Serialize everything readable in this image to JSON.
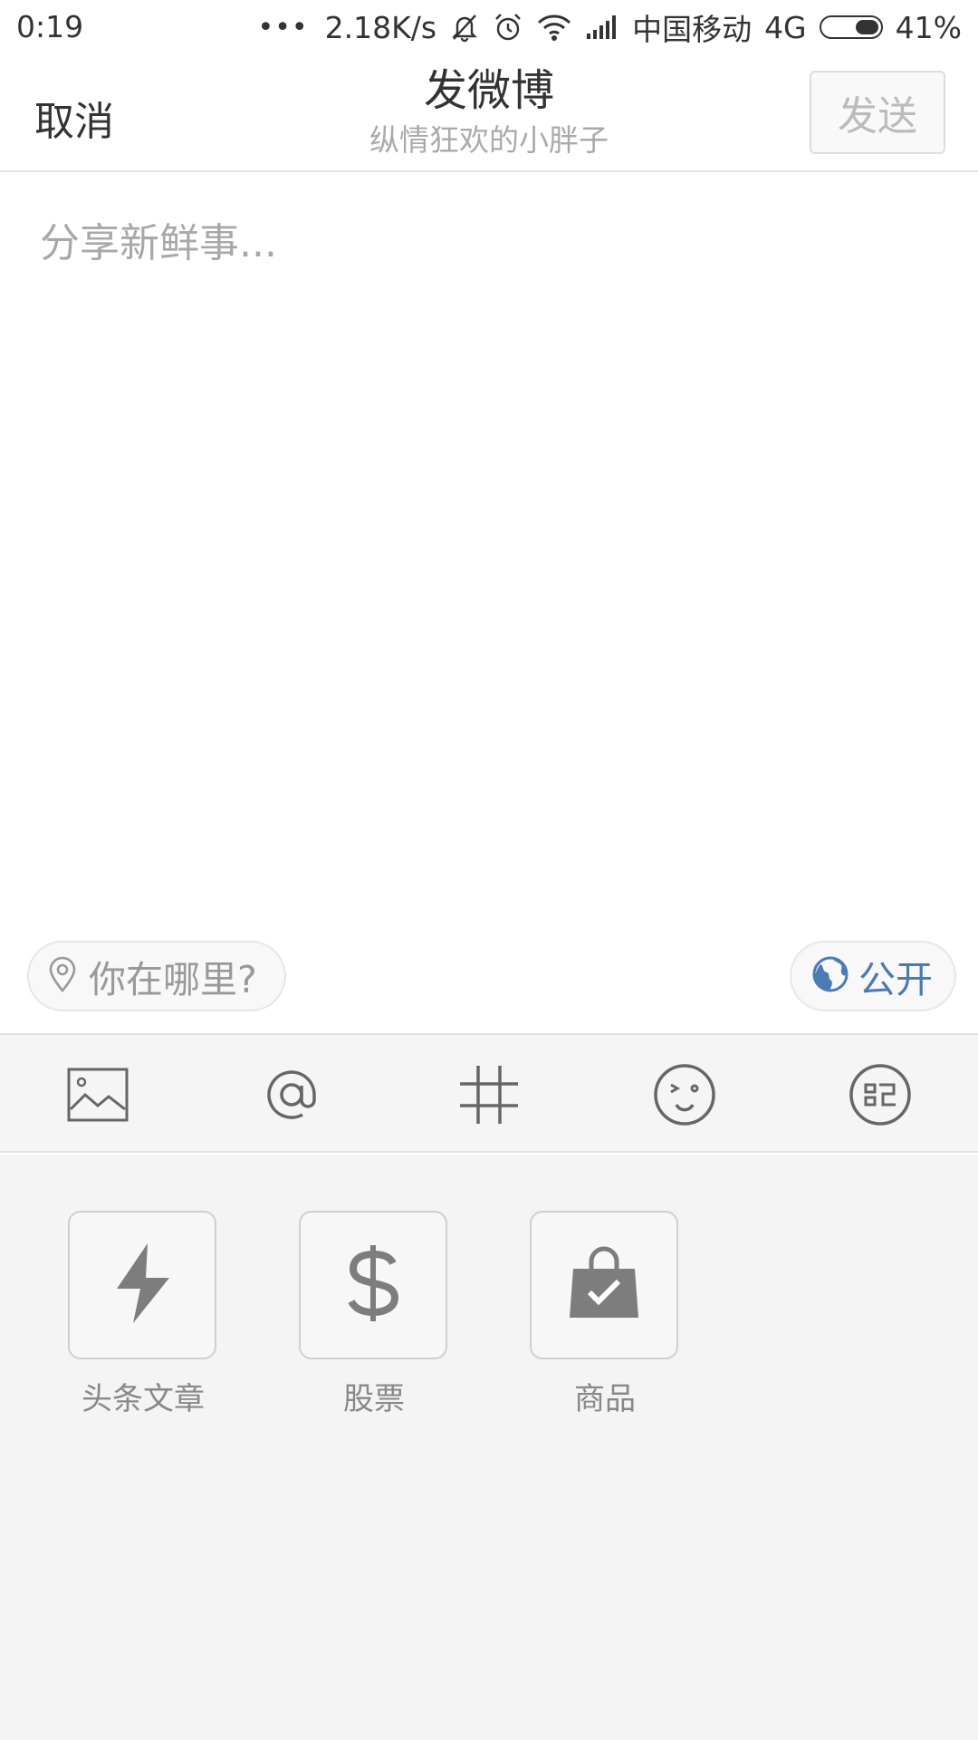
{
  "status_bar": {
    "time": "0:19",
    "dots": "•••",
    "network_speed": "2.18K/s",
    "carrier": "中国移动",
    "network_type": "4G",
    "battery_percent": "41%",
    "battery_level": 0.41
  },
  "header": {
    "cancel_label": "取消",
    "title": "发微博",
    "subtitle": "纵情狂欢的小胖子",
    "send_label": "发送"
  },
  "compose": {
    "placeholder": "分享新鲜事..."
  },
  "location": {
    "label": "你在哪里?"
  },
  "visibility": {
    "label": "公开",
    "accent_color": "#4a7bb3"
  },
  "toolbar": {
    "icons": [
      "image-icon",
      "at-mention-icon",
      "hashtag-icon",
      "emoji-icon",
      "more-icon"
    ]
  },
  "panel": {
    "items": [
      {
        "label": "头条文章",
        "icon": "lightning-icon"
      },
      {
        "label": "股票",
        "icon": "dollar-icon"
      },
      {
        "label": "商品",
        "icon": "shopping-bag-icon"
      }
    ]
  }
}
